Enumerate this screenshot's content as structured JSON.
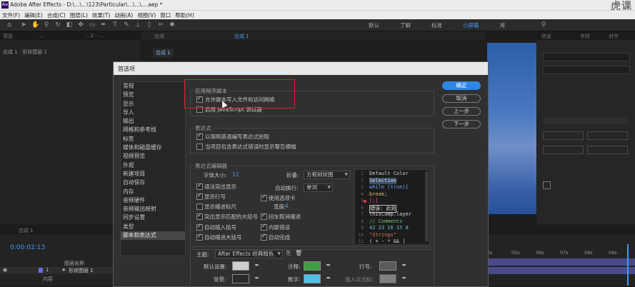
{
  "window": {
    "title": "Adobe After Effects - D:\\...\\...\\123\\Particular\\...\\...\\....aep *",
    "app_badge": "Ae",
    "brand": "虎课"
  },
  "menu": [
    "文件(F)",
    "编辑(E)",
    "合成(C)",
    "图层(L)",
    "效果(T)",
    "动画(A)",
    "视图(V)",
    "窗口",
    "帮助(H)"
  ],
  "workspaces": [
    "默认",
    "了解",
    "标准",
    "小屏幕",
    "库"
  ],
  "active_workspace": "小屏幕",
  "left_panel": {
    "tabs": [
      "项目",
      "...",
      "...1 - ..."
    ],
    "label": "合成 1 · 形状图层 1"
  },
  "comp_panel": {
    "tabs": [
      "合成",
      "合成 1"
    ],
    "breadcrumb": "合成 1"
  },
  "right_panel": {
    "tabs": [
      "信息",
      "字符",
      "对齐"
    ],
    "items": [
      "...",
      "...",
      "..."
    ]
  },
  "timeline": {
    "timecode": "0:00:02:13",
    "tab": "合成 1",
    "col_name": "图层名称",
    "layer_index": "1",
    "layer_name": "形状图层 1",
    "sub": "内容",
    "ruler": [
      "0s",
      "05s",
      "06s",
      "07s",
      "08s",
      "09s"
    ]
  },
  "dialog": {
    "title": "首选项",
    "nav": [
      "常规",
      "预览",
      "显示",
      "导入",
      "输出",
      "网格和参考线",
      "标签",
      "媒体和磁盘缓存",
      "视频预览",
      "外观",
      "新建项目",
      "自动保存",
      "内存",
      "音频硬件",
      "音频输出映射",
      "同步设置",
      "类型",
      "脚本和表达式"
    ],
    "nav_selected": "脚本和表达式",
    "buttons": {
      "ok": "确定",
      "cancel": "取消",
      "prev": "上一步",
      "next": "下一步"
    },
    "app_scripts": {
      "title": "应用程序脚本",
      "allow": "允许脚本写入文件和访问网络",
      "debugger": "启用 JavaScript 调试器"
    },
    "expressions": {
      "title": "表达式",
      "english": "以简明英语编写表达式拾取",
      "warn": "当项目包含表达式错误时显示警告横幅"
    },
    "editor": {
      "title": "表达式编辑器",
      "font_size_label": "字体大小:",
      "font_size": "12",
      "fold_label": "折叠:",
      "fold_value": "方框树状图",
      "wrap_label": "自动换行:",
      "wrap_value": "单词",
      "opts_left": [
        "语法突出显示",
        "显示行号",
        "显示缩进标尺",
        "突出显示匹配的大括号",
        "自动插入括号",
        "自动缩进大括号"
      ],
      "opts_right": [
        "使用选项卡",
        "回车取消缩进",
        "内联错误",
        "自动完成"
      ],
      "tab_width_label": "宽度:",
      "tab_width": "4",
      "code": [
        {
          "n": "1",
          "t": "Default Color",
          "c": "#d6d6d6"
        },
        {
          "n": "2",
          "t": "Selection",
          "c": "#e0e0e0"
        },
        {
          "n": "3",
          "t": "while (true){",
          "c": "#6aa6ff"
        },
        {
          "n": "4",
          "t": "          break;",
          "c": "#e0c06a"
        },
        {
          "n": "5",
          "t": "[;]",
          "c": "#e45a5a"
        },
        {
          "n": "6",
          "t": " 错误: 此处",
          "c": "#e0e0e0"
        },
        {
          "n": "7",
          "t": "thisComp.layer",
          "c": "#d6d6d6"
        },
        {
          "n": "8",
          "t": "// Comments",
          "c": "#6fbf6f"
        },
        {
          "n": "9",
          "t": "42 23 16 15 8",
          "c": "#62c0d8"
        },
        {
          "n": "10",
          "t": "\"Strings\"",
          "c": "#e07a5a"
        },
        {
          "n": "11",
          "t": "( + - * && |",
          "c": "#d6d6d6"
        }
      ]
    },
    "theme": {
      "label": "主题:",
      "value": "After Effects 经典暗色"
    },
    "colors": [
      {
        "label": "默认设置:",
        "color": "#cfcfcf"
      },
      {
        "label": "注释:",
        "color": "#3f9e3f"
      },
      {
        "label": "行号:",
        "color": "#5a5a5a"
      },
      {
        "label": "背景:",
        "color": "#2a2a2a"
      },
      {
        "label": "数字:",
        "color": "#4fc2e6"
      },
      {
        "label": "插入点光标:",
        "color": "#cfcfcf"
      }
    ]
  }
}
